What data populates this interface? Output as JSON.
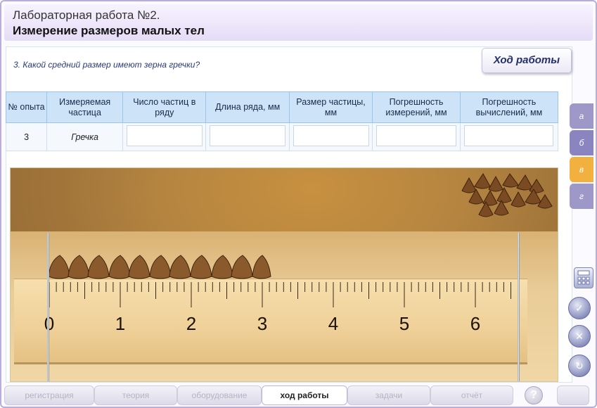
{
  "header": {
    "title_line1": "Лабораторная работа №2.",
    "title_line2": "Измерение размеров малых тел"
  },
  "procedure_button": "Ход работы",
  "question": "3. Какой средний размер имеют зерна гречки?",
  "table": {
    "columns": [
      "№ опыта",
      "Измеряемая частица",
      "Число частиц в ряду",
      "Длина ряда, мм",
      "Размер частицы, мм",
      "Погрешность измерений, мм",
      "Погрешность вычислений, мм"
    ],
    "rows": [
      {
        "number": "3",
        "particle": "Гречка",
        "count": "",
        "length": "",
        "size": "",
        "meas_error": "",
        "calc_error": ""
      }
    ]
  },
  "ruler": {
    "labels": [
      "0",
      "1",
      "2",
      "3",
      "4",
      "5",
      "6"
    ],
    "minor_ticks_per_unit": 10
  },
  "side_tabs": [
    {
      "label": "а",
      "color": "#9e98c8"
    },
    {
      "label": "б",
      "color": "#8a84c0"
    },
    {
      "label": "в",
      "color": "#f2b13e",
      "active": true
    },
    {
      "label": "г",
      "color": "#9e98c8"
    }
  ],
  "tool_icons": [
    "calculator-icon",
    "checkmark-icon",
    "close-icon",
    "refresh-icon"
  ],
  "nav": {
    "items": [
      {
        "label": "регистрация"
      },
      {
        "label": "теория"
      },
      {
        "label": "оборудование"
      },
      {
        "label": "ход работы",
        "active": true
      },
      {
        "label": "задачи"
      },
      {
        "label": "отчёт"
      }
    ],
    "help_label": "?"
  },
  "colors": {
    "header_bg": "#e5dcf6",
    "table_header_bg": "#cde3f7",
    "active_tab": "#f2b13e",
    "buckwheat": "#7a4a22"
  }
}
